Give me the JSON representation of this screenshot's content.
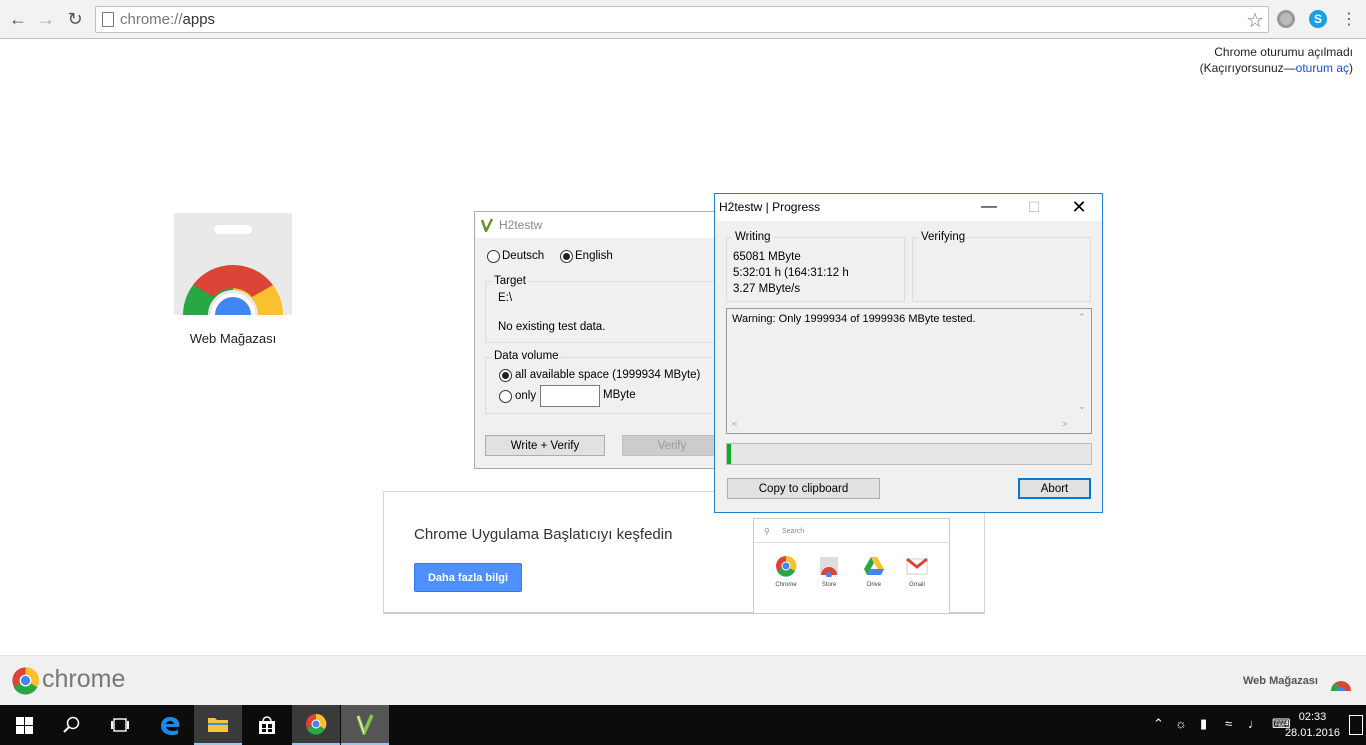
{
  "browser": {
    "url_scheme": "chrome://",
    "url_host": "apps",
    "signin_line1": "Chrome oturumu açılmadı",
    "signin_prefix": "(Kaçırıyorsunuz—",
    "signin_link": "oturum aç",
    "signin_suffix": ")"
  },
  "apps": [
    {
      "label": "Web Mağazası"
    }
  ],
  "promo": {
    "title": "Chrome Uygulama Başlatıcıyı keşfedin",
    "button": "Daha fazla bilgi",
    "search_placeholder": "Search",
    "mini_apps": [
      "Chrome",
      "Store",
      "Drive",
      "Gmail"
    ]
  },
  "h2testw_main": {
    "title": "H2testw",
    "lang_deutsch": "Deutsch",
    "lang_english": "English",
    "target_label": "Target",
    "target_value": "E:\\",
    "target_status": "No existing test data.",
    "data_volume_label": "Data volume",
    "opt_all": "all available space (1999934 MByte)",
    "opt_only": "only",
    "unit": "MByte",
    "only_value": "",
    "btn_write_verify": "Write + Verify",
    "btn_verify": "Verify"
  },
  "h2testw_progress": {
    "title": "H2testw | Progress",
    "writing_label": "Writing",
    "written": "65081 MByte",
    "time": "5:32:01 h (164:31:12 h",
    "speed": "3.27 MByte/s",
    "verifying_label": "Verifying",
    "log": "Warning: Only 1999934 of 1999936 MByte tested.",
    "progress_fraction": 0.01,
    "btn_copy": "Copy to clipboard",
    "btn_abort": "Abort"
  },
  "footer": {
    "brand": "chrome",
    "store_link": "Web Mağazası"
  },
  "taskbar": {
    "time": "02:33",
    "date": "28.01.2016"
  }
}
